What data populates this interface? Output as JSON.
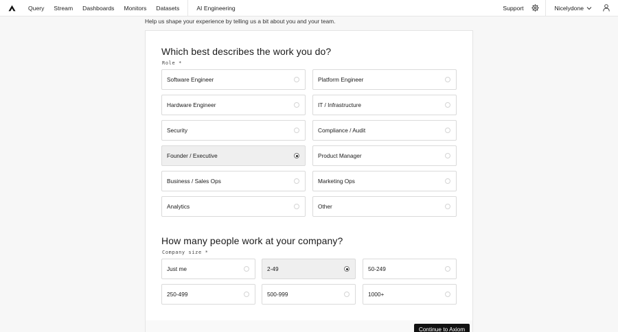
{
  "nav": {
    "items": [
      "Query",
      "Stream",
      "Dashboards",
      "Monitors",
      "Datasets"
    ],
    "extra": "AI Engineering",
    "support": "Support",
    "org": "Nicelydone"
  },
  "icons": {
    "logo": "axiom-logo-icon",
    "settings": "gear-icon",
    "dropdown": "chevron-down-icon",
    "user": "user-icon"
  },
  "subtitle": "Help us shape your experience by telling us a bit about you and your team.",
  "role": {
    "heading": "Which best describes the work you do?",
    "label": "Role *",
    "options": [
      "Software Engineer",
      "Platform Engineer",
      "Hardware Engineer",
      "IT / Infrastructure",
      "Security",
      "Compliance / Audit",
      "Founder / Executive",
      "Product Manager",
      "Business / Sales Ops",
      "Marketing Ops",
      "Analytics",
      "Other"
    ],
    "selected": "Founder / Executive"
  },
  "company": {
    "heading": "How many people work at your company?",
    "label": "Company size *",
    "options": [
      "Just me",
      "2-49",
      "50-249",
      "250-499",
      "500-999",
      "1000+"
    ],
    "selected": "2-49"
  },
  "continue_label": "Continue to Axiom",
  "colors": {
    "accent": "#111111",
    "selected_bg": "#efefef",
    "border": "#dadada"
  }
}
